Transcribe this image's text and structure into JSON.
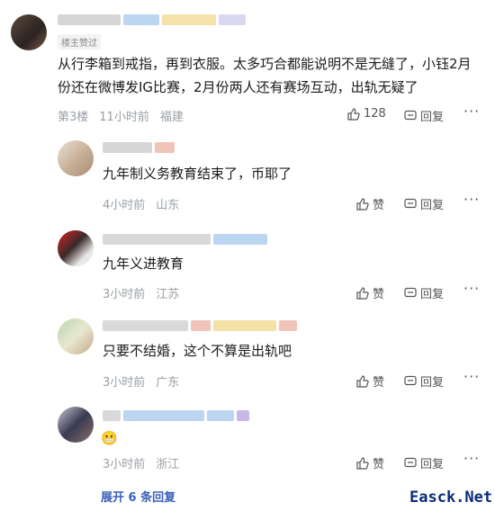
{
  "main_comment": {
    "badge": "楼主赞过",
    "text_line1": "从行李箱到戒指，再到衣服。太多巧合都能说明不是无缝了，小钰2月",
    "text_line2": "份还在微博发IG比赛，2月份两人还有赛场互动，出轨无疑了",
    "floor": "第3楼",
    "time": "11小时前",
    "location": "福建",
    "likes": "128",
    "reply_label": "回复"
  },
  "replies": [
    {
      "text": "九年制义务教育结束了，币耶了",
      "time": "4小时前",
      "location": "山东",
      "like_label": "赞",
      "reply_label": "回复"
    },
    {
      "text": "九年义进教育",
      "time": "3小时前",
      "location": "江苏",
      "like_label": "赞",
      "reply_label": "回复"
    },
    {
      "text": "只要不结婚，这个不算是出轨吧",
      "time": "3小时前",
      "location": "广东",
      "like_label": "赞",
      "reply_label": "回复"
    },
    {
      "text": "😬",
      "time": "3小时前",
      "location": "浙江",
      "like_label": "赞",
      "reply_label": "回复"
    }
  ],
  "expand_label": "展开 6 条回复",
  "watermark": "Easck.Net",
  "colors": {
    "meta": "#9aa0a6",
    "expand": "#3a5fb8",
    "watermark": "#0a2a7a"
  }
}
